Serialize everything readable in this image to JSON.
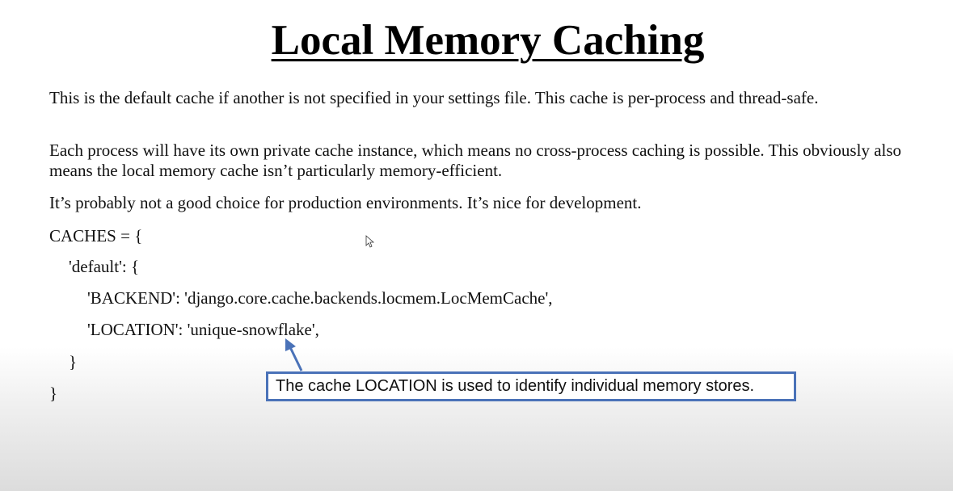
{
  "slide": {
    "title": "Local Memory Caching",
    "paragraphs": [
      "This is the default cache if another is not specified in your settings file. This cache is per-process and thread-safe.",
      "Each process will have its own private cache instance, which means no cross-process caching is possible. This obviously also means the local memory cache isn’t particularly memory-efficient.",
      "It’s probably not a good choice for production environments. It’s nice for development."
    ],
    "code_lines": [
      "CACHES = {",
      "'default': {",
      "'BACKEND': 'django.core.cache.backends.locmem.LocMemCache',",
      "'LOCATION': 'unique-snowflake',",
      "}",
      "}"
    ],
    "callout": "The cache LOCATION is used to identify individual memory stores.",
    "colors": {
      "callout_border": "#4a72b8",
      "arrow": "#4a72b8"
    }
  }
}
